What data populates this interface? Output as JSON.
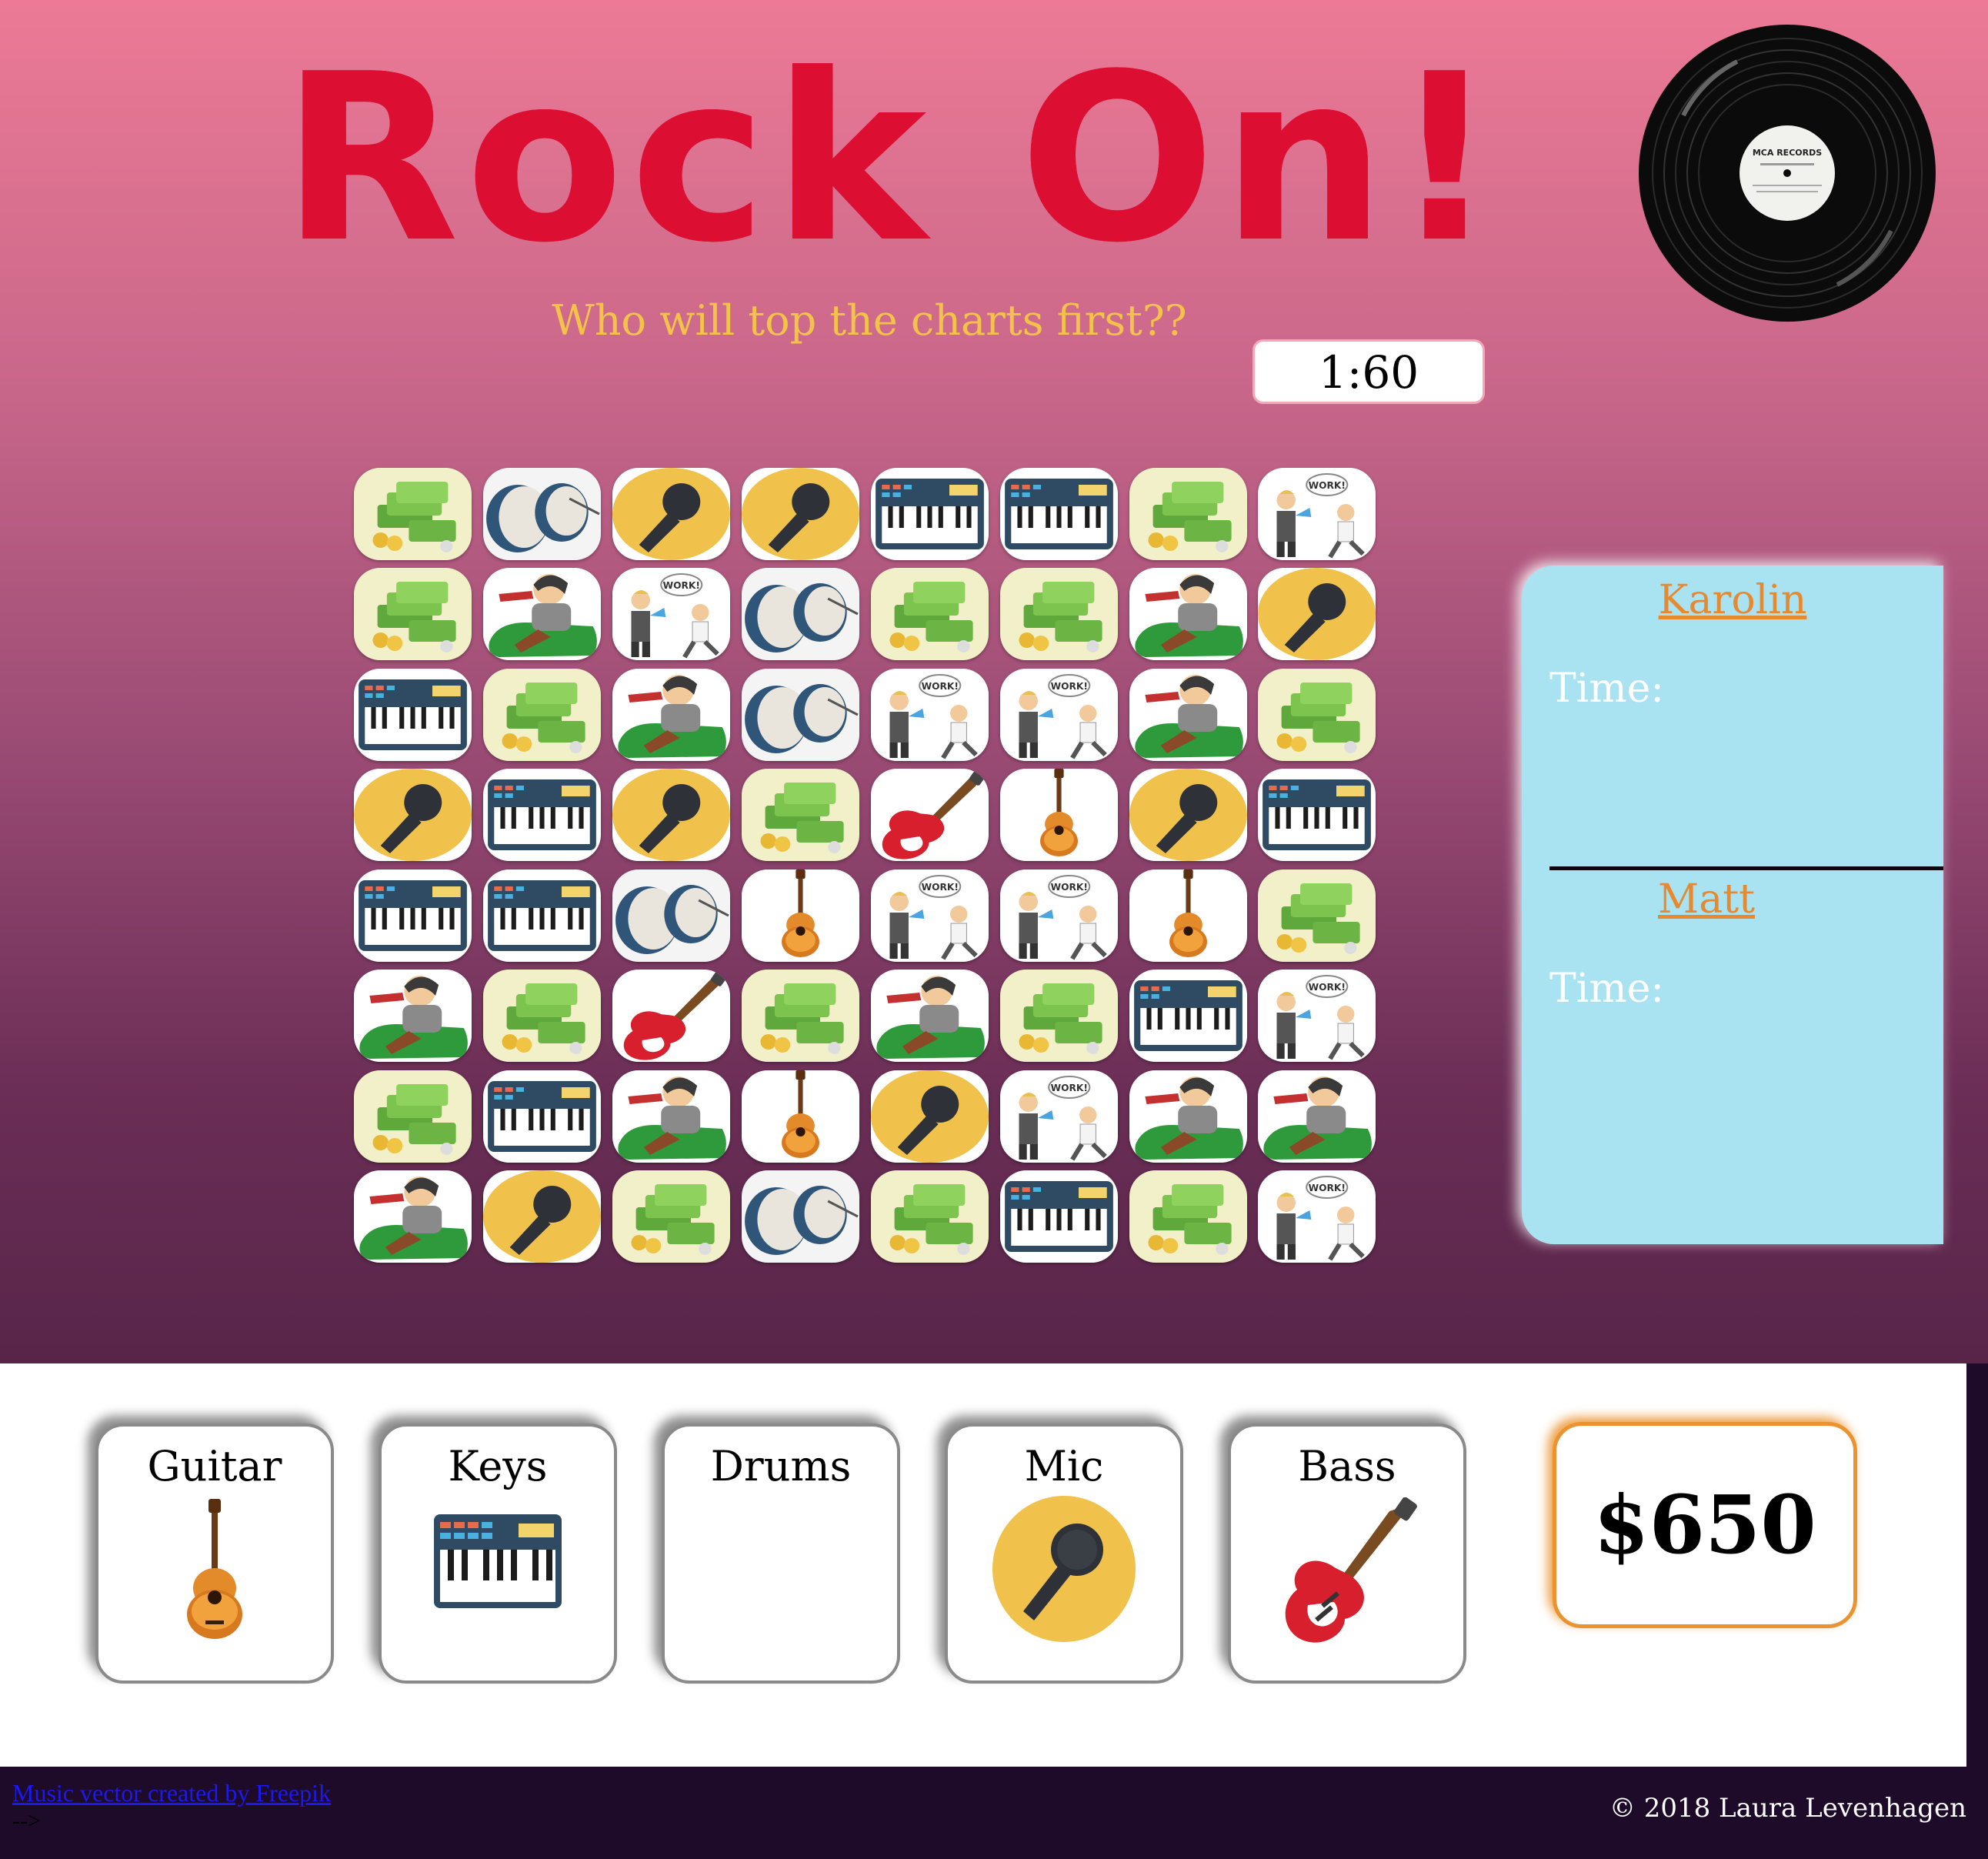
{
  "header": {
    "title": "Rock On!",
    "tagline": "Who will top the charts first??",
    "timer": "1:60",
    "record_label_text": "MCA RECORDS"
  },
  "board": {
    "rows": [
      [
        "money",
        "drums",
        "mic",
        "mic",
        "keys",
        "keys",
        "money",
        "work"
      ],
      [
        "money",
        "rockstar",
        "work",
        "drums",
        "money",
        "money",
        "rockstar",
        "mic"
      ],
      [
        "keys",
        "money",
        "rockstar",
        "drums",
        "work",
        "work",
        "rockstar",
        "money"
      ],
      [
        "mic",
        "keys",
        "mic",
        "money",
        "bass",
        "guitar",
        "mic",
        "keys"
      ],
      [
        "keys",
        "keys",
        "drums",
        "guitar",
        "work",
        "work",
        "guitar",
        "money"
      ],
      [
        "rockstar",
        "money",
        "bass",
        "money",
        "rockstar",
        "money",
        "keys",
        "work"
      ],
      [
        "money",
        "keys",
        "rockstar",
        "guitar",
        "mic",
        "work",
        "rockstar",
        "rockstar"
      ],
      [
        "rockstar",
        "mic",
        "money",
        "drums",
        "money",
        "keys",
        "money",
        "work"
      ]
    ]
  },
  "players": [
    {
      "name": "Karolin",
      "time_label": "Time:"
    },
    {
      "name": "Matt",
      "time_label": "Time:"
    }
  ],
  "instruments": [
    {
      "label": "Guitar",
      "icon": "guitar",
      "collected": true
    },
    {
      "label": "Keys",
      "icon": "keys",
      "collected": true
    },
    {
      "label": "Drums",
      "icon": "drums",
      "collected": false
    },
    {
      "label": "Mic",
      "icon": "mic",
      "collected": true
    },
    {
      "label": "Bass",
      "icon": "bass",
      "collected": true
    }
  ],
  "money": "$650",
  "footer": {
    "credit": "Music vector created by Freepik",
    "stray": "-->",
    "copyright": "© 2018 Laura Levenhagen"
  },
  "colors": {
    "title": "#dc0f33",
    "tagline": "#f3c248",
    "scoreboard": "#a9e2f1",
    "player_name": "#e6892f",
    "money_border": "#ec9330"
  }
}
